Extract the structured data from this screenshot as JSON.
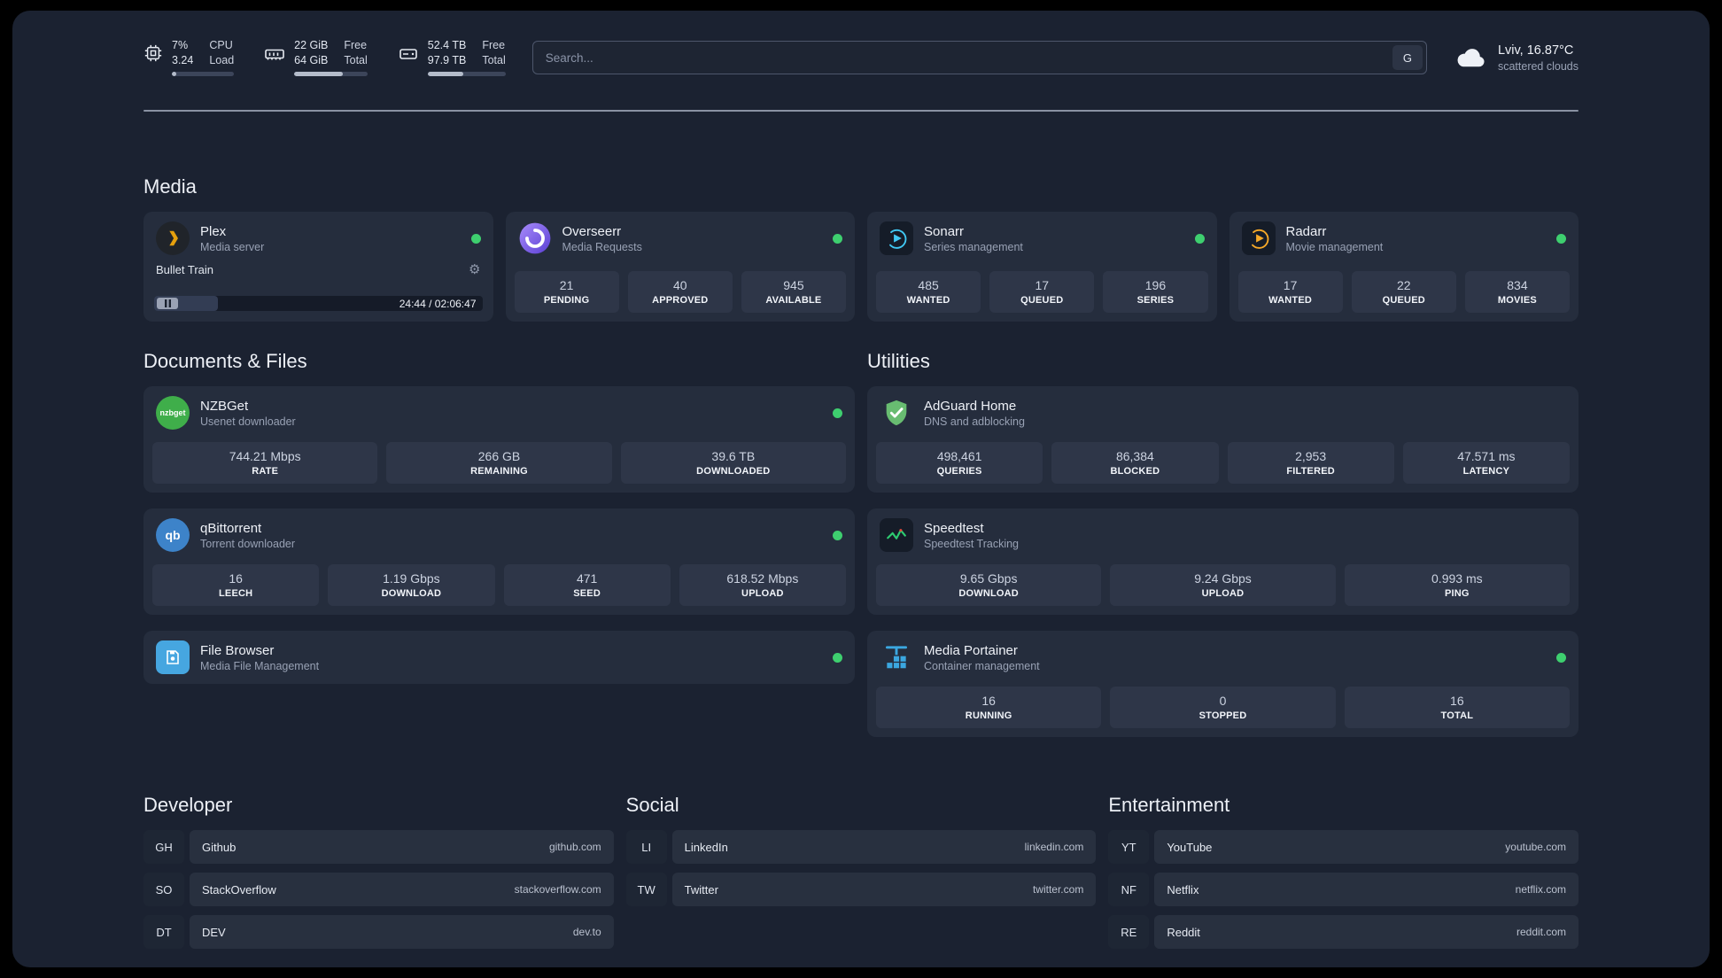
{
  "topbar": {
    "cpu": {
      "value1": "7%",
      "label1": "CPU",
      "value2": "3.24",
      "label2": "Load",
      "percent": 7
    },
    "memory": {
      "value1": "22 GiB",
      "label1": "Free",
      "value2": "64 GiB",
      "label2": "Total",
      "percent": 66
    },
    "disk": {
      "value1": "52.4 TB",
      "label1": "Free",
      "value2": "97.9 TB",
      "label2": "Total",
      "percent": 46
    },
    "search": {
      "placeholder": "Search...",
      "engine_button": "G"
    },
    "weather": {
      "location": "Lviv, 16.87°C",
      "condition": "scattered clouds"
    }
  },
  "sections": {
    "media": "Media",
    "documents": "Documents & Files",
    "utilities": "Utilities",
    "developer": "Developer",
    "social": "Social",
    "entertainment": "Entertainment"
  },
  "apps": {
    "plex": {
      "name": "Plex",
      "description": "Media server",
      "player": {
        "title": "Bullet Train",
        "time": "24:44 / 02:06:47",
        "progress_percent": 19.5
      }
    },
    "overseerr": {
      "name": "Overseerr",
      "description": "Media Requests",
      "stats": [
        {
          "value": "21",
          "label": "PENDING"
        },
        {
          "value": "40",
          "label": "APPROVED"
        },
        {
          "value": "945",
          "label": "AVAILABLE"
        }
      ]
    },
    "sonarr": {
      "name": "Sonarr",
      "description": "Series management",
      "stats": [
        {
          "value": "485",
          "label": "WANTED"
        },
        {
          "value": "17",
          "label": "QUEUED"
        },
        {
          "value": "196",
          "label": "SERIES"
        }
      ]
    },
    "radarr": {
      "name": "Radarr",
      "description": "Movie management",
      "stats": [
        {
          "value": "17",
          "label": "WANTED"
        },
        {
          "value": "22",
          "label": "QUEUED"
        },
        {
          "value": "834",
          "label": "MOVIES"
        }
      ]
    },
    "nzbget": {
      "name": "NZBGet",
      "description": "Usenet downloader",
      "icon_text": "nzbget",
      "stats": [
        {
          "value": "744.21 Mbps",
          "label": "RATE"
        },
        {
          "value": "266 GB",
          "label": "REMAINING"
        },
        {
          "value": "39.6 TB",
          "label": "DOWNLOADED"
        }
      ]
    },
    "qbittorrent": {
      "name": "qBittorrent",
      "description": "Torrent downloader",
      "icon_text": "qb",
      "stats": [
        {
          "value": "16",
          "label": "LEECH"
        },
        {
          "value": "1.19 Gbps",
          "label": "DOWNLOAD"
        },
        {
          "value": "471",
          "label": "SEED"
        },
        {
          "value": "618.52 Mbps",
          "label": "UPLOAD"
        }
      ]
    },
    "filebrowser": {
      "name": "File Browser",
      "description": "Media File Management"
    },
    "adguard": {
      "name": "AdGuard Home",
      "description": "DNS and adblocking",
      "stats": [
        {
          "value": "498,461",
          "label": "QUERIES"
        },
        {
          "value": "86,384",
          "label": "BLOCKED"
        },
        {
          "value": "2,953",
          "label": "FILTERED"
        },
        {
          "value": "47.571 ms",
          "label": "LATENCY"
        }
      ]
    },
    "speedtest": {
      "name": "Speedtest",
      "description": "Speedtest Tracking",
      "stats": [
        {
          "value": "9.65 Gbps",
          "label": "DOWNLOAD"
        },
        {
          "value": "9.24 Gbps",
          "label": "UPLOAD"
        },
        {
          "value": "0.993 ms",
          "label": "PING"
        }
      ]
    },
    "portainer": {
      "name": "Media Portainer",
      "description": "Container management",
      "stats": [
        {
          "value": "16",
          "label": "RUNNING"
        },
        {
          "value": "0",
          "label": "STOPPED"
        },
        {
          "value": "16",
          "label": "TOTAL"
        }
      ]
    }
  },
  "bookmarks": {
    "developer": [
      {
        "abbr": "GH",
        "name": "Github",
        "url": "github.com"
      },
      {
        "abbr": "SO",
        "name": "StackOverflow",
        "url": "stackoverflow.com"
      },
      {
        "abbr": "DT",
        "name": "DEV",
        "url": "dev.to"
      }
    ],
    "social": [
      {
        "abbr": "LI",
        "name": "LinkedIn",
        "url": "linkedin.com"
      },
      {
        "abbr": "TW",
        "name": "Twitter",
        "url": "twitter.com"
      }
    ],
    "entertainment": [
      {
        "abbr": "YT",
        "name": "YouTube",
        "url": "youtube.com"
      },
      {
        "abbr": "NF",
        "name": "Netflix",
        "url": "netflix.com"
      },
      {
        "abbr": "RE",
        "name": "Reddit",
        "url": "reddit.com"
      }
    ]
  }
}
